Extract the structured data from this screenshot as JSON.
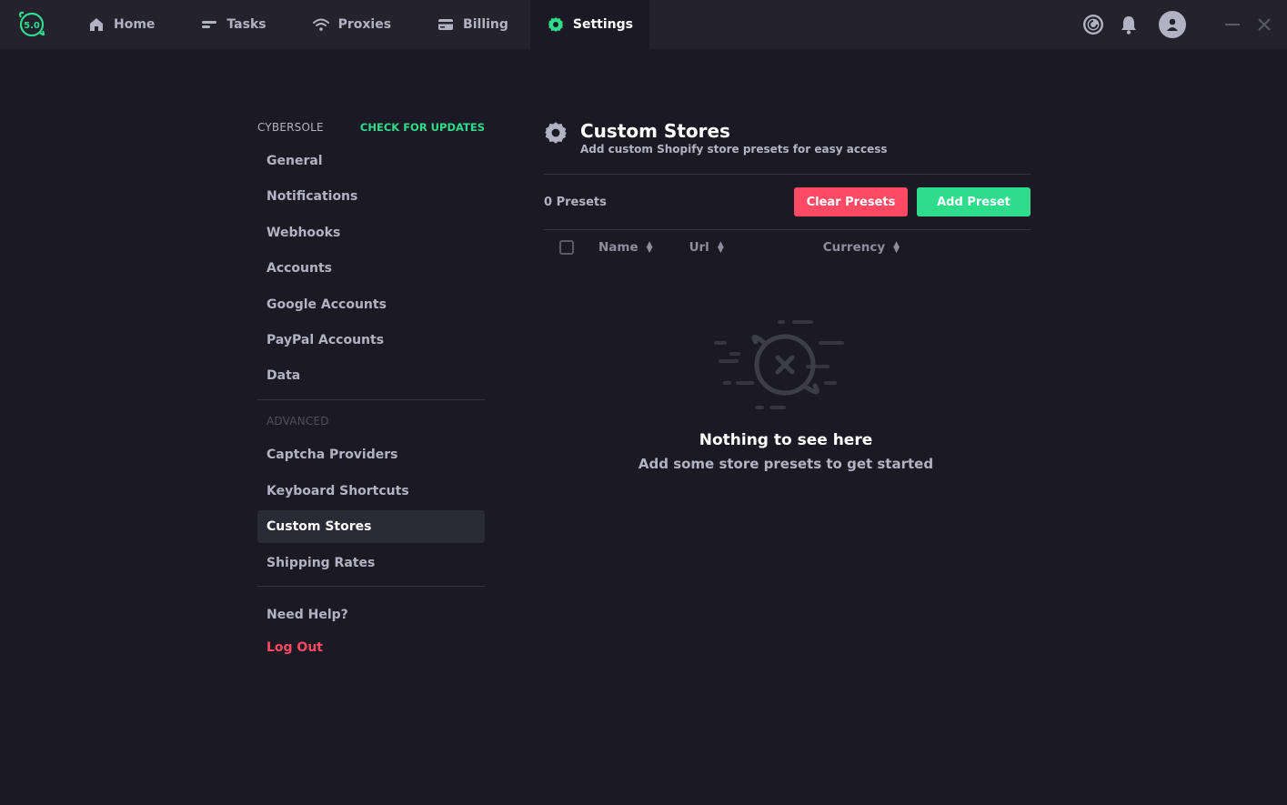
{
  "app": {
    "version_badge": "5.0",
    "accent": "#2fdc8c",
    "danger": "#ff4a64"
  },
  "nav": {
    "items": [
      {
        "label": "Home",
        "icon": "home-icon"
      },
      {
        "label": "Tasks",
        "icon": "tasks-icon"
      },
      {
        "label": "Proxies",
        "icon": "wifi-icon"
      },
      {
        "label": "Billing",
        "icon": "card-icon"
      },
      {
        "label": "Settings",
        "icon": "gear-icon",
        "active": true
      }
    ]
  },
  "topright": {
    "icons": [
      "captcha-icon",
      "bell-icon",
      "user-avatar-icon",
      "minimize-icon",
      "close-icon"
    ]
  },
  "sidebar": {
    "section1_title": "CYBERSOLE",
    "updates_link": "CHECK FOR UPDATES",
    "items": [
      "General",
      "Notifications",
      "Webhooks",
      "Accounts",
      "Google Accounts",
      "PayPal Accounts",
      "Data"
    ],
    "section2_title": "ADVANCED",
    "advanced_items": [
      "Captcha Providers",
      "Keyboard Shortcuts",
      "Custom Stores",
      "Shipping Rates"
    ],
    "active_item": "Custom Stores",
    "help": "Need Help?",
    "logout": "Log Out"
  },
  "main": {
    "title": "Custom Stores",
    "subtitle": "Add custom Shopify store presets for easy access",
    "count": "0 Presets",
    "clear_btn": "Clear Presets",
    "add_btn": "Add Preset",
    "columns": [
      "Name",
      "Url",
      "Currency"
    ],
    "empty_title": "Nothing to see here",
    "empty_sub": "Add some store presets to get started"
  }
}
